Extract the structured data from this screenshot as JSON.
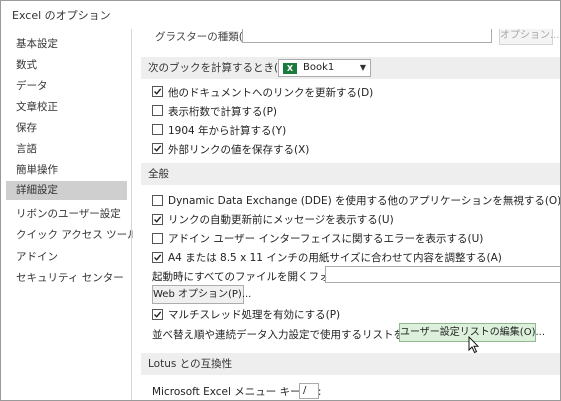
{
  "window": {
    "title": "Excel のオプション"
  },
  "sidebar": {
    "items": [
      {
        "label": "基本設定"
      },
      {
        "label": "数式"
      },
      {
        "label": "データ"
      },
      {
        "label": "文章校正"
      },
      {
        "label": "保存"
      },
      {
        "label": "言語"
      },
      {
        "label": "簡単操作"
      },
      {
        "label": "詳細設定",
        "selected": true
      },
      {
        "label": "リボンのユーザー設定"
      },
      {
        "label": "クイック アクセス ツール バー"
      },
      {
        "label": "アドイン"
      },
      {
        "label": "セキュリティ センター"
      }
    ]
  },
  "top_partial": {
    "label": "グラスターの種類(C):",
    "button": "オプション..."
  },
  "calc_section": {
    "header": "次のブックを計算するとき(H):",
    "workbook": "Book1",
    "options": [
      {
        "label": "他のドキュメントへのリンクを更新する(D)",
        "checked": true
      },
      {
        "label": "表示桁数で計算する(P)",
        "checked": false
      },
      {
        "label": "1904 年から計算する(Y)",
        "checked": false
      },
      {
        "label": "外部リンクの値を保存する(X)",
        "checked": true
      }
    ]
  },
  "general_section": {
    "header": "全般",
    "options": [
      {
        "label": "Dynamic Data Exchange (DDE) を使用する他のアプリケーションを無視する(O)",
        "checked": false
      },
      {
        "label": "リンクの自動更新前にメッセージを表示する(U)",
        "checked": true
      },
      {
        "label": "アドイン ユーザー インターフェイスに関するエラーを表示する(U)",
        "checked": false
      },
      {
        "label": "A4 または 8.5 x 11 インチの用紙サイズに合わせて内容を調整する(A)",
        "checked": true
      }
    ],
    "startup_folder_label": "起動時にすべてのファイルを開くフォルダー(L):",
    "startup_folder_value": "",
    "web_options_button": "Web オプション(P)...",
    "multithread": {
      "label": "マルチスレッド処理を有効にする(P)",
      "checked": true
    },
    "custom_lists_label": "並べ替え順や連続データ入力設定で使用するリストを作成します:",
    "custom_lists_button": "ユーザー設定リストの編集(O)..."
  },
  "lotus_section": {
    "header": "Lotus との互換性",
    "menu_key_label": "Microsoft Excel メニュー キー(M):",
    "menu_key_value": "/"
  }
}
